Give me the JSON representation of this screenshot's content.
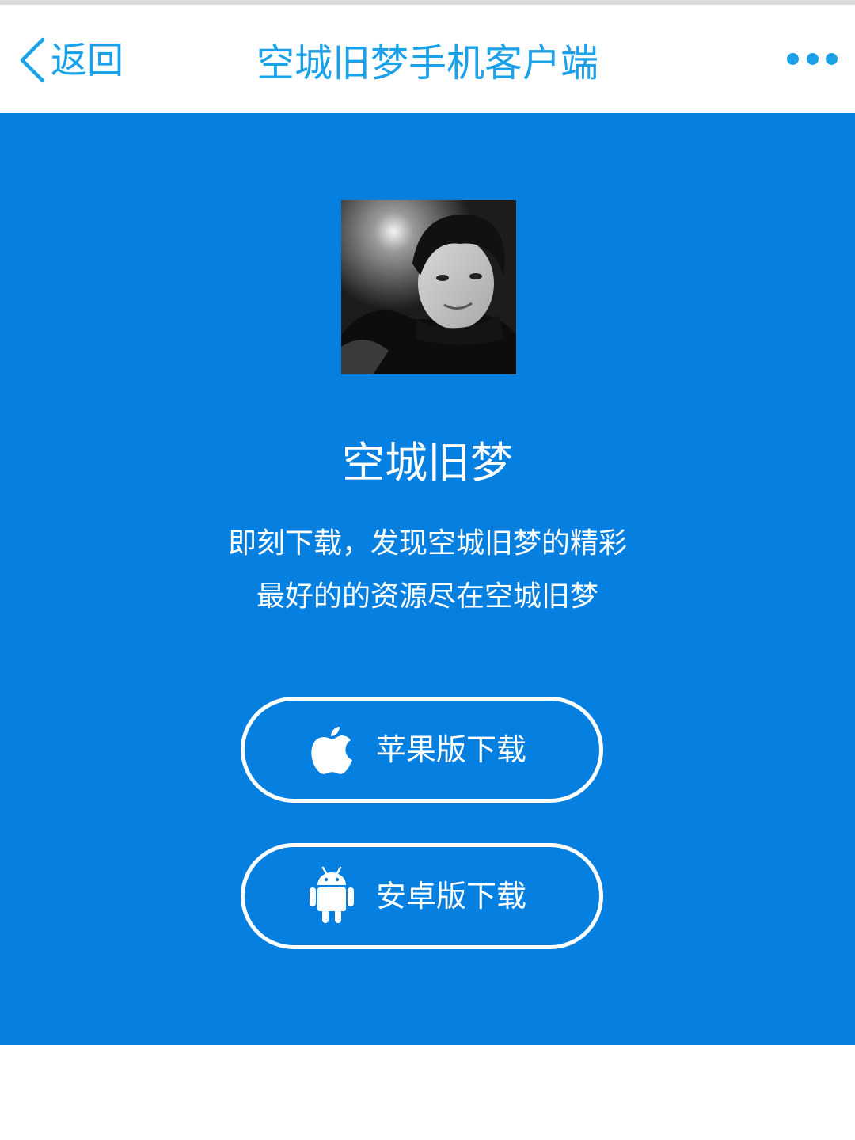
{
  "nav": {
    "back_label": "返回",
    "title": "空城旧梦手机客户端",
    "more_icon": "more-dots-icon",
    "accent_color": "#1aa1e8"
  },
  "hero": {
    "background_color": "#0680e0",
    "avatar_description_icon": "avatar-photo",
    "app_name": "空城旧梦",
    "tagline_line1": "即刻下载，发现空城旧梦的精彩",
    "tagline_line2": "最好的的资源尽在空城旧梦"
  },
  "downloads": {
    "ios_label": "苹果版下载",
    "ios_icon": "apple-icon",
    "android_label": "安卓版下载",
    "android_icon": "android-icon"
  }
}
